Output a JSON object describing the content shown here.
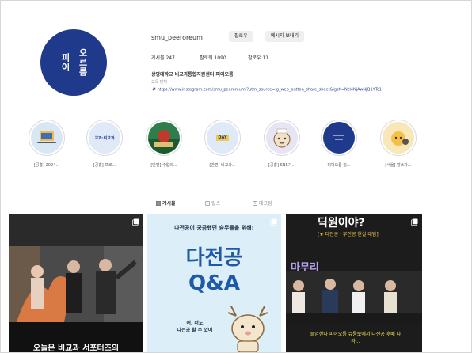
{
  "profile": {
    "avatar_text_left": "피어",
    "avatar_text_right": "오르름",
    "username": "smu_peeroreum",
    "follow_button": "팔로우",
    "message_button": "메시지 보내기",
    "posts_stat": "게시물 247",
    "followers_stat": "팔로워 1090",
    "following_stat": "팔로우 11",
    "bio_name": "상명대학교 비교과통합지원센터 피어오름",
    "bio_category": "교육 단체",
    "bio_link": "https://www.instagram.com/smu_peeroreum/?utm_source=ig_web_button_share_sheet&igsh=NzI4NjAwNjQ1YTc1"
  },
  "highlights": [
    {
      "label": "[공홍] 2024...",
      "color": "#d9e7f5",
      "icon": "laptop-icon"
    },
    {
      "label": "[공홍] 프로...",
      "color": "#dfe9f8",
      "icon": "text-badge",
      "text": "교과·비교과"
    },
    {
      "label": "[반편] 수업의...",
      "color": "#2e7d4a",
      "icon": "photo-icon"
    },
    {
      "label": "[반편] 비교과...",
      "color": "#dfe9f8",
      "icon": "text-badge",
      "text": "DAY"
    },
    {
      "label": "[공홍] SNS기...",
      "color": "#e7e4f3",
      "icon": "character-icon"
    },
    {
      "label": "피어오름 질...",
      "color": "#1f3a8a",
      "icon": "logo-icon"
    },
    {
      "label": "[서울] 알쓰자...",
      "color": "#f8e7b8",
      "icon": "character-icon"
    }
  ],
  "tabs": {
    "posts": "게시물",
    "reels": "릴스",
    "tagged": "태그됨"
  },
  "posts": {
    "post1_caption": "오늘은 비교과 서포터즈의",
    "post2_top": "다전공이 궁금했던 슝무들을 위해!",
    "post2_title_line1": "다전공",
    "post2_title_line2": "Q&A",
    "post2_speech": "어, 너도\n다전공 할 수 있어",
    "post3_top": "딕원이야?",
    "post3_sub": "[★ 다전공 · 부전공 현실 대담]",
    "post3_title": "마무리",
    "post3_caption": "졸업한다 피어오름 뮤퉁보에서 다전공 후배 다라..."
  },
  "colors": {
    "brand": "#1f3a8a",
    "post2_title": "#1e5aa8"
  }
}
